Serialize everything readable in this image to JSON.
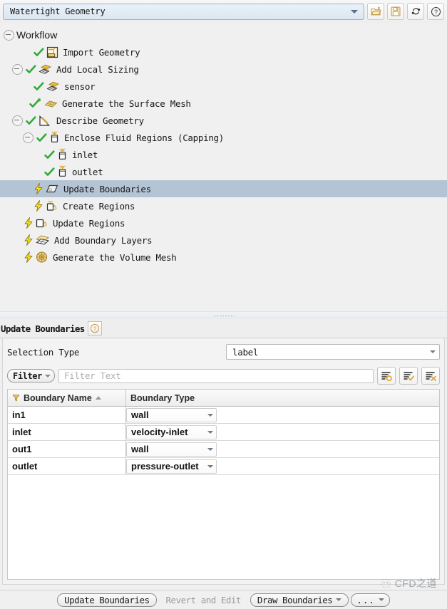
{
  "topbar": {
    "workflow_combo_value": "Watertight Geometry",
    "buttons": [
      {
        "name": "open-folder-icon",
        "tooltip": "Open"
      },
      {
        "name": "save-icon",
        "tooltip": "Save"
      },
      {
        "name": "reset-icon",
        "tooltip": "Reset Workflow"
      },
      {
        "name": "help-icon",
        "tooltip": "Help"
      }
    ]
  },
  "tree": {
    "root_label": "Workflow",
    "nodes": [
      {
        "label": "Import Geometry",
        "indent": 1,
        "state": "done",
        "icon": "cad-box-icon",
        "expander": false
      },
      {
        "label": "Add Local Sizing",
        "indent": 1,
        "state": "done",
        "icon": "local-sizing-icon",
        "expander": true
      },
      {
        "label": "sensor",
        "indent": 2,
        "state": "done",
        "icon": "local-sizing-icon",
        "expander": false
      },
      {
        "label": "Generate the Surface Mesh",
        "indent": 1,
        "state": "updated",
        "icon": "surface-mesh-icon",
        "expander": false
      },
      {
        "label": "Describe Geometry",
        "indent": 1,
        "state": "done",
        "icon": "describe-geom-icon",
        "expander": true
      },
      {
        "label": "Enclose Fluid Regions (Capping)",
        "indent": 2,
        "state": "done",
        "icon": "capping-icon",
        "expander": true
      },
      {
        "label": "inlet",
        "indent": 3,
        "state": "done",
        "icon": "capping-icon",
        "expander": false
      },
      {
        "label": "outlet",
        "indent": 3,
        "state": "done",
        "icon": "capping-icon",
        "expander": false
      },
      {
        "label": "Update Boundaries",
        "indent": 2,
        "state": "pending",
        "icon": "boundary-icon",
        "expander": false,
        "selected": true
      },
      {
        "label": "Create Regions",
        "indent": 2,
        "state": "pending",
        "icon": "create-regions-icon",
        "expander": false
      },
      {
        "label": "Update Regions",
        "indent": 1,
        "state": "pending",
        "icon": "update-regions-icon",
        "expander": false
      },
      {
        "label": "Add Boundary Layers",
        "indent": 1,
        "state": "pending",
        "icon": "boundary-layers-icon",
        "expander": false
      },
      {
        "label": "Generate the Volume Mesh",
        "indent": 1,
        "state": "pending",
        "icon": "volume-mesh-icon",
        "expander": false
      }
    ]
  },
  "task": {
    "title": "Update Boundaries",
    "help_icon": "help-icon",
    "selection_type_label": "Selection Type",
    "selection_type_value": "label",
    "filter_button_label": "Filter",
    "filter_input_placeholder": "Filter Text",
    "list_buttons": [
      {
        "name": "list-select-none-icon"
      },
      {
        "name": "list-select-all-icon"
      },
      {
        "name": "list-clear-icon"
      }
    ],
    "table": {
      "columns": [
        "Boundary Name",
        "Boundary Type"
      ],
      "sort_column": "Boundary Name",
      "sort_direction": "asc",
      "rows": [
        {
          "name": "in1",
          "type": "wall"
        },
        {
          "name": "inlet",
          "type": "velocity-inlet"
        },
        {
          "name": "out1",
          "type": "wall"
        },
        {
          "name": "outlet",
          "type": "pressure-outlet"
        }
      ]
    }
  },
  "bottom": {
    "update_label": "Update Boundaries",
    "revert_label": "Revert and Edit",
    "draw_label": "Draw Boundaries",
    "more_label": "..."
  },
  "watermark": {
    "text": "CFD之道"
  },
  "colors": {
    "check_green": "#2faa39",
    "bolt_yellow": "#f5d623",
    "selection_blue": "#b4c4d4",
    "accent_gold": "#d9a52b"
  }
}
